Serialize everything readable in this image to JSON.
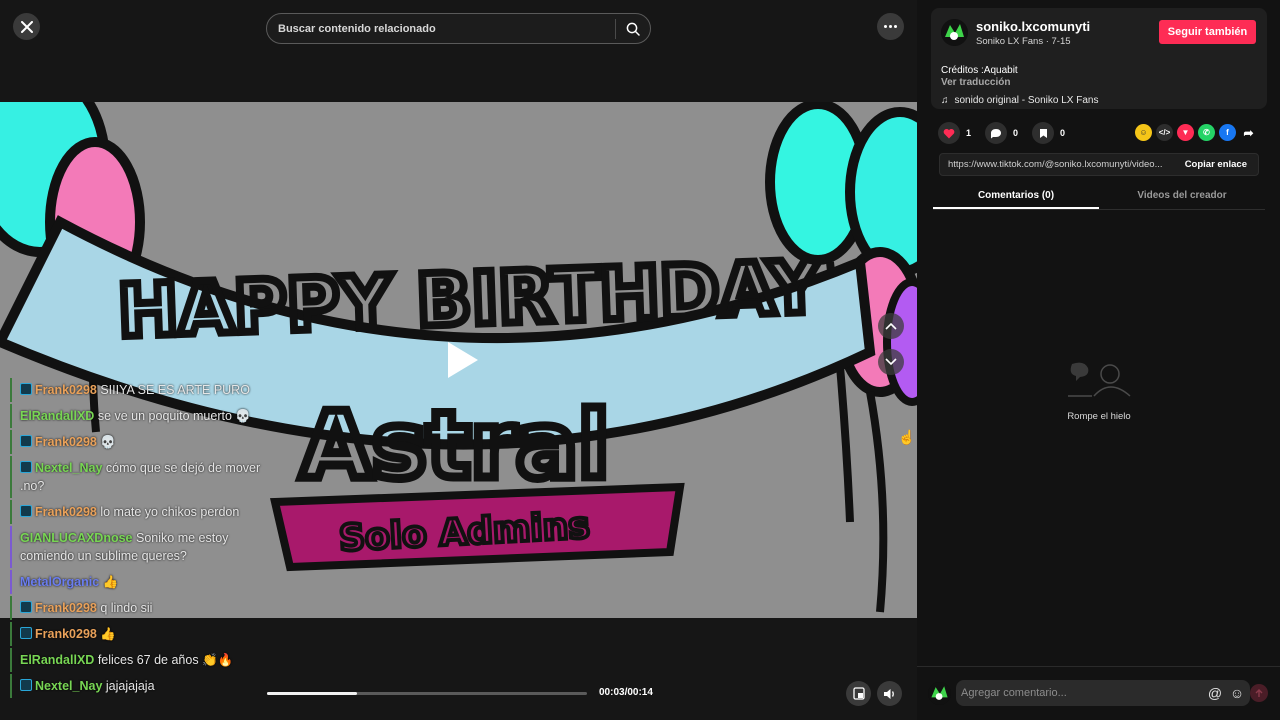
{
  "player": {
    "search": {
      "placeholder": "Buscar contenido relacionado"
    },
    "time": "00:03/00:14",
    "progress": 0.28
  },
  "chat": [
    {
      "user": "Frank0298",
      "text": "SIIIYA SE ES ARTE PURO",
      "badge": true,
      "color": "orange"
    },
    {
      "user": "ElRandallXD",
      "text": "se ve un poquito muerto 💀",
      "badge": false,
      "color": "green"
    },
    {
      "user": "Frank0298",
      "text": "💀",
      "badge": true,
      "color": "orange"
    },
    {
      "user": "Nextel_Nay",
      "text": "cómo que se dejó de mover .no?",
      "badge": true,
      "color": "green"
    },
    {
      "user": "Frank0298",
      "text": "lo mate yo chikos perdon",
      "badge": true,
      "color": "orange"
    },
    {
      "user": "GIANLUCAXDnose",
      "text": "Soniko me estoy comiendo un sublime queres?",
      "badge": false,
      "color": "green"
    },
    {
      "user": "MetalOrganic",
      "text": "👍",
      "badge": false,
      "color": "blue"
    },
    {
      "user": "Frank0298",
      "text": "q lindo sii",
      "badge": true,
      "color": "orange"
    },
    {
      "user": "Frank0298",
      "text": "👍",
      "badge": true,
      "color": "orange"
    },
    {
      "user": "ElRandallXD",
      "text": "felices 67 de años 👏🔥",
      "badge": false,
      "color": "green"
    },
    {
      "user": "Nextel_Nay",
      "text": "jajajajaja",
      "badge": true,
      "color": "green"
    }
  ],
  "creator": {
    "username": "soniko.lxcomunyti",
    "nickname": "Soniko LX Fans · 7-15",
    "follow_label": "Seguir también",
    "credits": "Créditos :Aquabit",
    "translate": "Ver traducción",
    "sound": "sonido original - Soniko LX Fans"
  },
  "stats": {
    "likes": "1",
    "comments": "0",
    "saves": "0"
  },
  "share": {
    "link": "https://www.tiktok.com/@soniko.lxcomunyti/video...",
    "copy_label": "Copiar enlace"
  },
  "tabs": [
    "Comentarios (0)",
    "Videos del creador"
  ],
  "empty_state": "Rompe el hielo",
  "comment": {
    "placeholder": "Agregar comentario..."
  },
  "colors": {
    "accent": "#fe2c55",
    "panel_bg": "#121212"
  },
  "artwork_text": {
    "banner": "HAPPY BIRTHDAY",
    "name": "Astral",
    "ribbon": "Solo Admins"
  }
}
